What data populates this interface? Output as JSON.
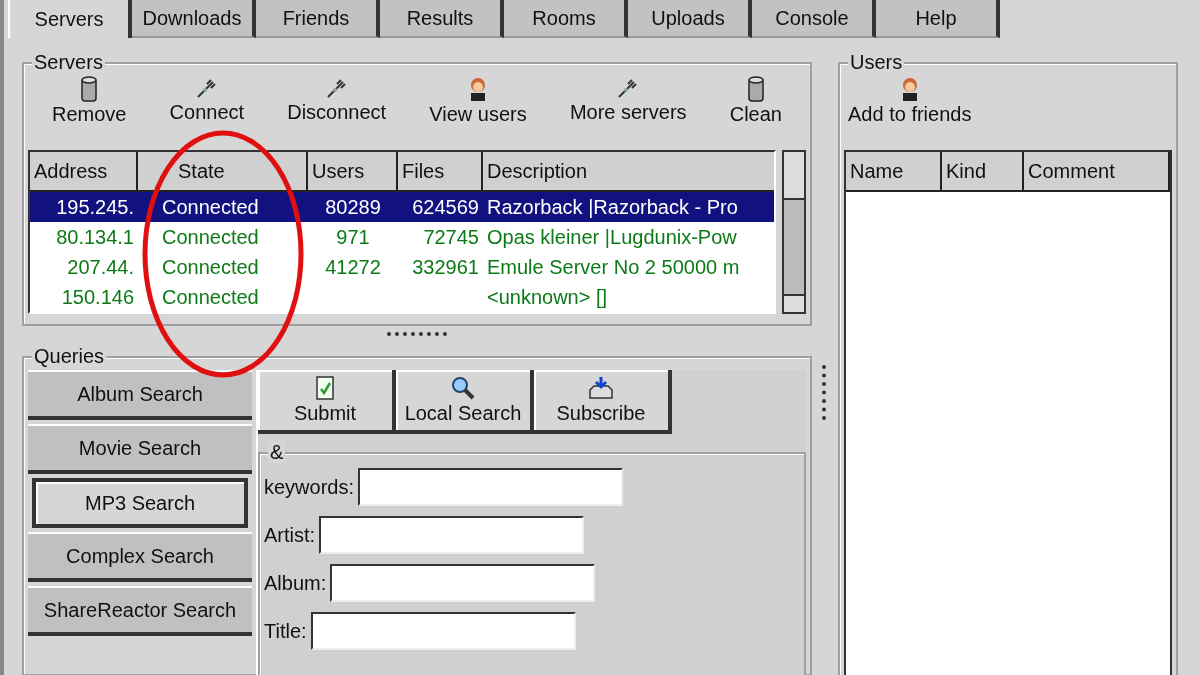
{
  "tabs": [
    {
      "label": "Servers",
      "selected": true
    },
    {
      "label": "Downloads",
      "selected": false
    },
    {
      "label": "Friends",
      "selected": false
    },
    {
      "label": "Results",
      "selected": false
    },
    {
      "label": "Rooms",
      "selected": false
    },
    {
      "label": "Uploads",
      "selected": false
    },
    {
      "label": "Console",
      "selected": false
    },
    {
      "label": "Help",
      "selected": false
    }
  ],
  "servers": {
    "title": "Servers",
    "toolbar": [
      {
        "label": "Remove",
        "kind": "can"
      },
      {
        "label": "Connect",
        "kind": "plug"
      },
      {
        "label": "Disconnect",
        "kind": "plug"
      },
      {
        "label": "View users",
        "kind": "person"
      },
      {
        "label": "More servers",
        "kind": "plug"
      },
      {
        "label": "Clean",
        "kind": "can"
      }
    ],
    "columns": [
      "Address",
      "State",
      "Users",
      "Files",
      "Description"
    ],
    "rows": [
      {
        "cells": [
          "195.245.",
          "Connected",
          "80289",
          "624569",
          "Razorback |Razorback - Pro"
        ],
        "selected": true
      },
      {
        "cells": [
          "80.134.1",
          "Connected",
          "971",
          "72745",
          "Opas kleiner |Lugdunix-Pow"
        ],
        "selected": false
      },
      {
        "cells": [
          "207.44.",
          "Connected",
          "41272",
          "332961",
          "Emule Server No 2 50000 m"
        ],
        "selected": false
      },
      {
        "cells": [
          "150.146",
          "Connected",
          "",
          "",
          "<unknown> []"
        ],
        "selected": false
      }
    ]
  },
  "users": {
    "title": "Users",
    "toolbar": [
      {
        "label": "Add to friends",
        "kind": "person"
      }
    ],
    "columns": [
      "Name",
      "Kind",
      "Comment"
    ]
  },
  "queries": {
    "title": "Queries",
    "tabs": [
      {
        "label": "Album Search",
        "selected": false
      },
      {
        "label": "Movie Search",
        "selected": false
      },
      {
        "label": "MP3 Search",
        "selected": true
      },
      {
        "label": "Complex Search",
        "selected": false
      },
      {
        "label": "ShareReactor Search",
        "selected": false
      }
    ],
    "actions": [
      {
        "label": "Submit",
        "kind": "page"
      },
      {
        "label": "Local Search",
        "kind": "magnifier"
      },
      {
        "label": "Subscribe",
        "kind": "tray"
      }
    ],
    "form": {
      "title": "&",
      "fields": [
        {
          "label": "keywords:"
        },
        {
          "label": "Artist:"
        },
        {
          "label": "Album:"
        },
        {
          "label": "Title:"
        }
      ]
    }
  }
}
